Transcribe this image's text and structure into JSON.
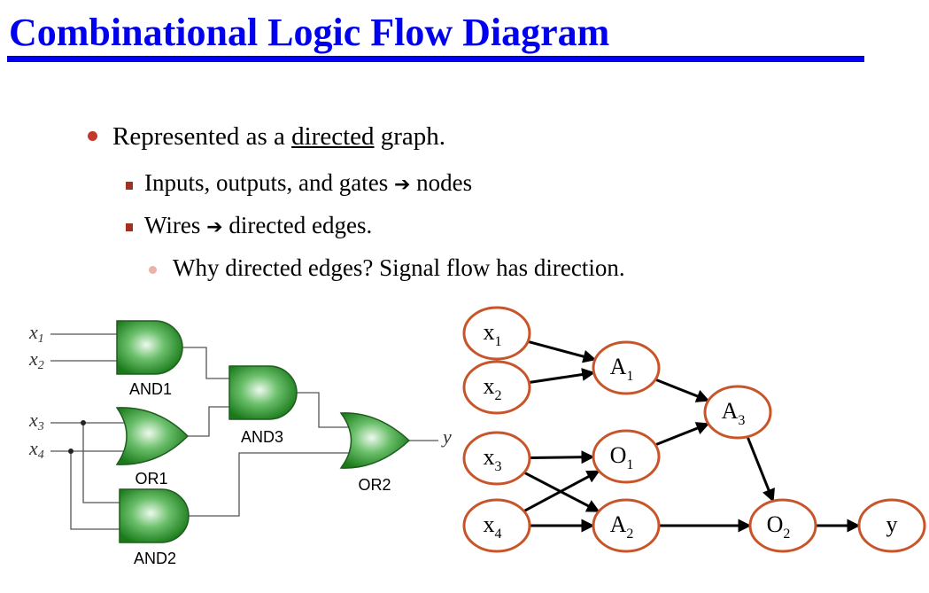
{
  "title": "Combinational Logic Flow Diagram",
  "bullets": {
    "b1_prefix": "Represented as a ",
    "b1_underlined": "directed",
    "b1_suffix": " graph.",
    "b2_before": "Inputs, outputs, and gates ",
    "b2_after": " nodes",
    "b3_before": "Wires ",
    "b3_after": " directed edges.",
    "b4": "Why directed edges? Signal flow has direction.",
    "arrow_glyph": "➔"
  },
  "schematic": {
    "inputs": [
      {
        "base": "x",
        "sub": "1"
      },
      {
        "base": "x",
        "sub": "2"
      },
      {
        "base": "x",
        "sub": "3"
      },
      {
        "base": "x",
        "sub": "4"
      }
    ],
    "output": "y",
    "gates": [
      {
        "id": "AND1",
        "label": "AND1"
      },
      {
        "id": "OR1",
        "label": "OR1"
      },
      {
        "id": "AND3",
        "label": "AND3"
      },
      {
        "id": "AND2",
        "label": "AND2"
      },
      {
        "id": "OR2",
        "label": "OR2"
      }
    ]
  },
  "graph": {
    "nodes": [
      {
        "id": "x1",
        "base": "x",
        "sub": "1"
      },
      {
        "id": "x2",
        "base": "x",
        "sub": "2"
      },
      {
        "id": "x3",
        "base": "x",
        "sub": "3"
      },
      {
        "id": "x4",
        "base": "x",
        "sub": "4"
      },
      {
        "id": "A1",
        "base": "A",
        "sub": "1"
      },
      {
        "id": "O1",
        "base": "O",
        "sub": "1"
      },
      {
        "id": "A2",
        "base": "A",
        "sub": "2"
      },
      {
        "id": "A3",
        "base": "A",
        "sub": "3"
      },
      {
        "id": "O2",
        "base": "O",
        "sub": "2"
      },
      {
        "id": "y",
        "base": "y",
        "sub": ""
      }
    ],
    "edges": [
      [
        "x1",
        "A1"
      ],
      [
        "x2",
        "A1"
      ],
      [
        "x3",
        "O1"
      ],
      [
        "x3",
        "A2"
      ],
      [
        "x4",
        "O1"
      ],
      [
        "x4",
        "A2"
      ],
      [
        "A1",
        "A3"
      ],
      [
        "O1",
        "A3"
      ],
      [
        "A3",
        "O2"
      ],
      [
        "A2",
        "O2"
      ],
      [
        "O2",
        "y"
      ]
    ]
  },
  "colors": {
    "title": "#0000ee",
    "node_stroke": "#c8552a",
    "gate_fill_light": "#d8f0d8",
    "gate_fill_dark": "#1a7a1a"
  }
}
